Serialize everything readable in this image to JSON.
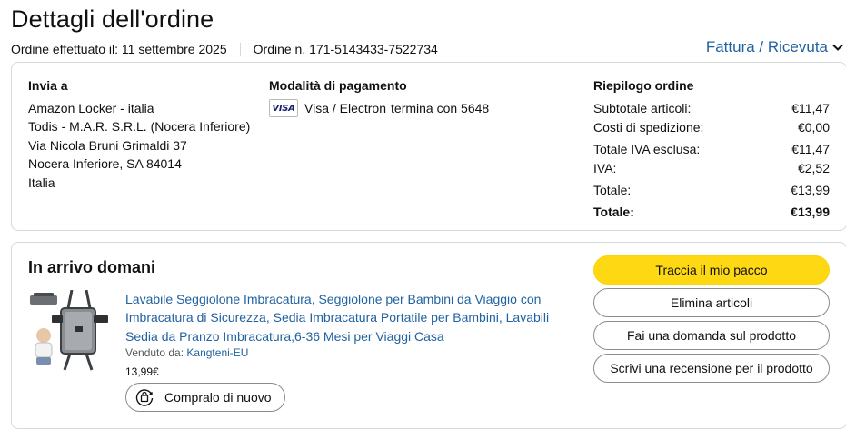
{
  "header": {
    "title": "Dettagli dell'ordine",
    "order_date": "Ordine effettuato il: 11 settembre 2025",
    "order_number": "Ordine n. 171-5143433-7522734",
    "invoice_link": "Fattura / Ricevuta"
  },
  "shipping": {
    "heading": "Invia a",
    "lines": [
      "Amazon Locker - italia",
      "Todis - M.A.R. S.R.L. (Nocera Inferiore)",
      "Via Nicola Bruni Grimaldi 37",
      "Nocera Inferiore, SA 84014",
      "Italia"
    ]
  },
  "payment": {
    "heading": "Modalità di pagamento",
    "card_logo": "VISA",
    "card_type": "Visa / Electron",
    "ending": "termina con 5648"
  },
  "summary": {
    "heading": "Riepilogo ordine",
    "rows": [
      {
        "label": "Subtotale articoli:",
        "value": "€11,47"
      },
      {
        "label": "Costi di spedizione:",
        "value": "€0,00"
      },
      {
        "label": "Totale IVA esclusa:",
        "value": "€11,47"
      },
      {
        "label": "IVA:",
        "value": "€2,52"
      },
      {
        "label": "Totale:",
        "value": "€13,99"
      },
      {
        "label": "Totale:",
        "value": "€13,99"
      }
    ]
  },
  "shipment": {
    "status": "In arrivo domani",
    "product": {
      "title": "Lavabile Seggiolone Imbracatura, Seggiolone per Bambini da Viaggio con Imbracatura di Sicurezza, Sedia Imbracatura Portatile per Bambini, Lavabili Sedia da Pranzo Imbracatura,6-36 Mesi per Viaggi Casa",
      "sold_by_label": "Venduto da:",
      "seller": "Kangteni-EU",
      "price": "13,99€",
      "buy_again": "Compralo di nuovo"
    },
    "actions": {
      "track": "Traccia il mio pacco",
      "delete": "Elimina articoli",
      "ask": "Fai una domanda sul prodotto",
      "review": "Scrivi una recensione per il prodotto"
    }
  },
  "colors": {
    "link": "#2162a1",
    "primary_button": "#ffd814",
    "border": "#d5d9d9"
  }
}
